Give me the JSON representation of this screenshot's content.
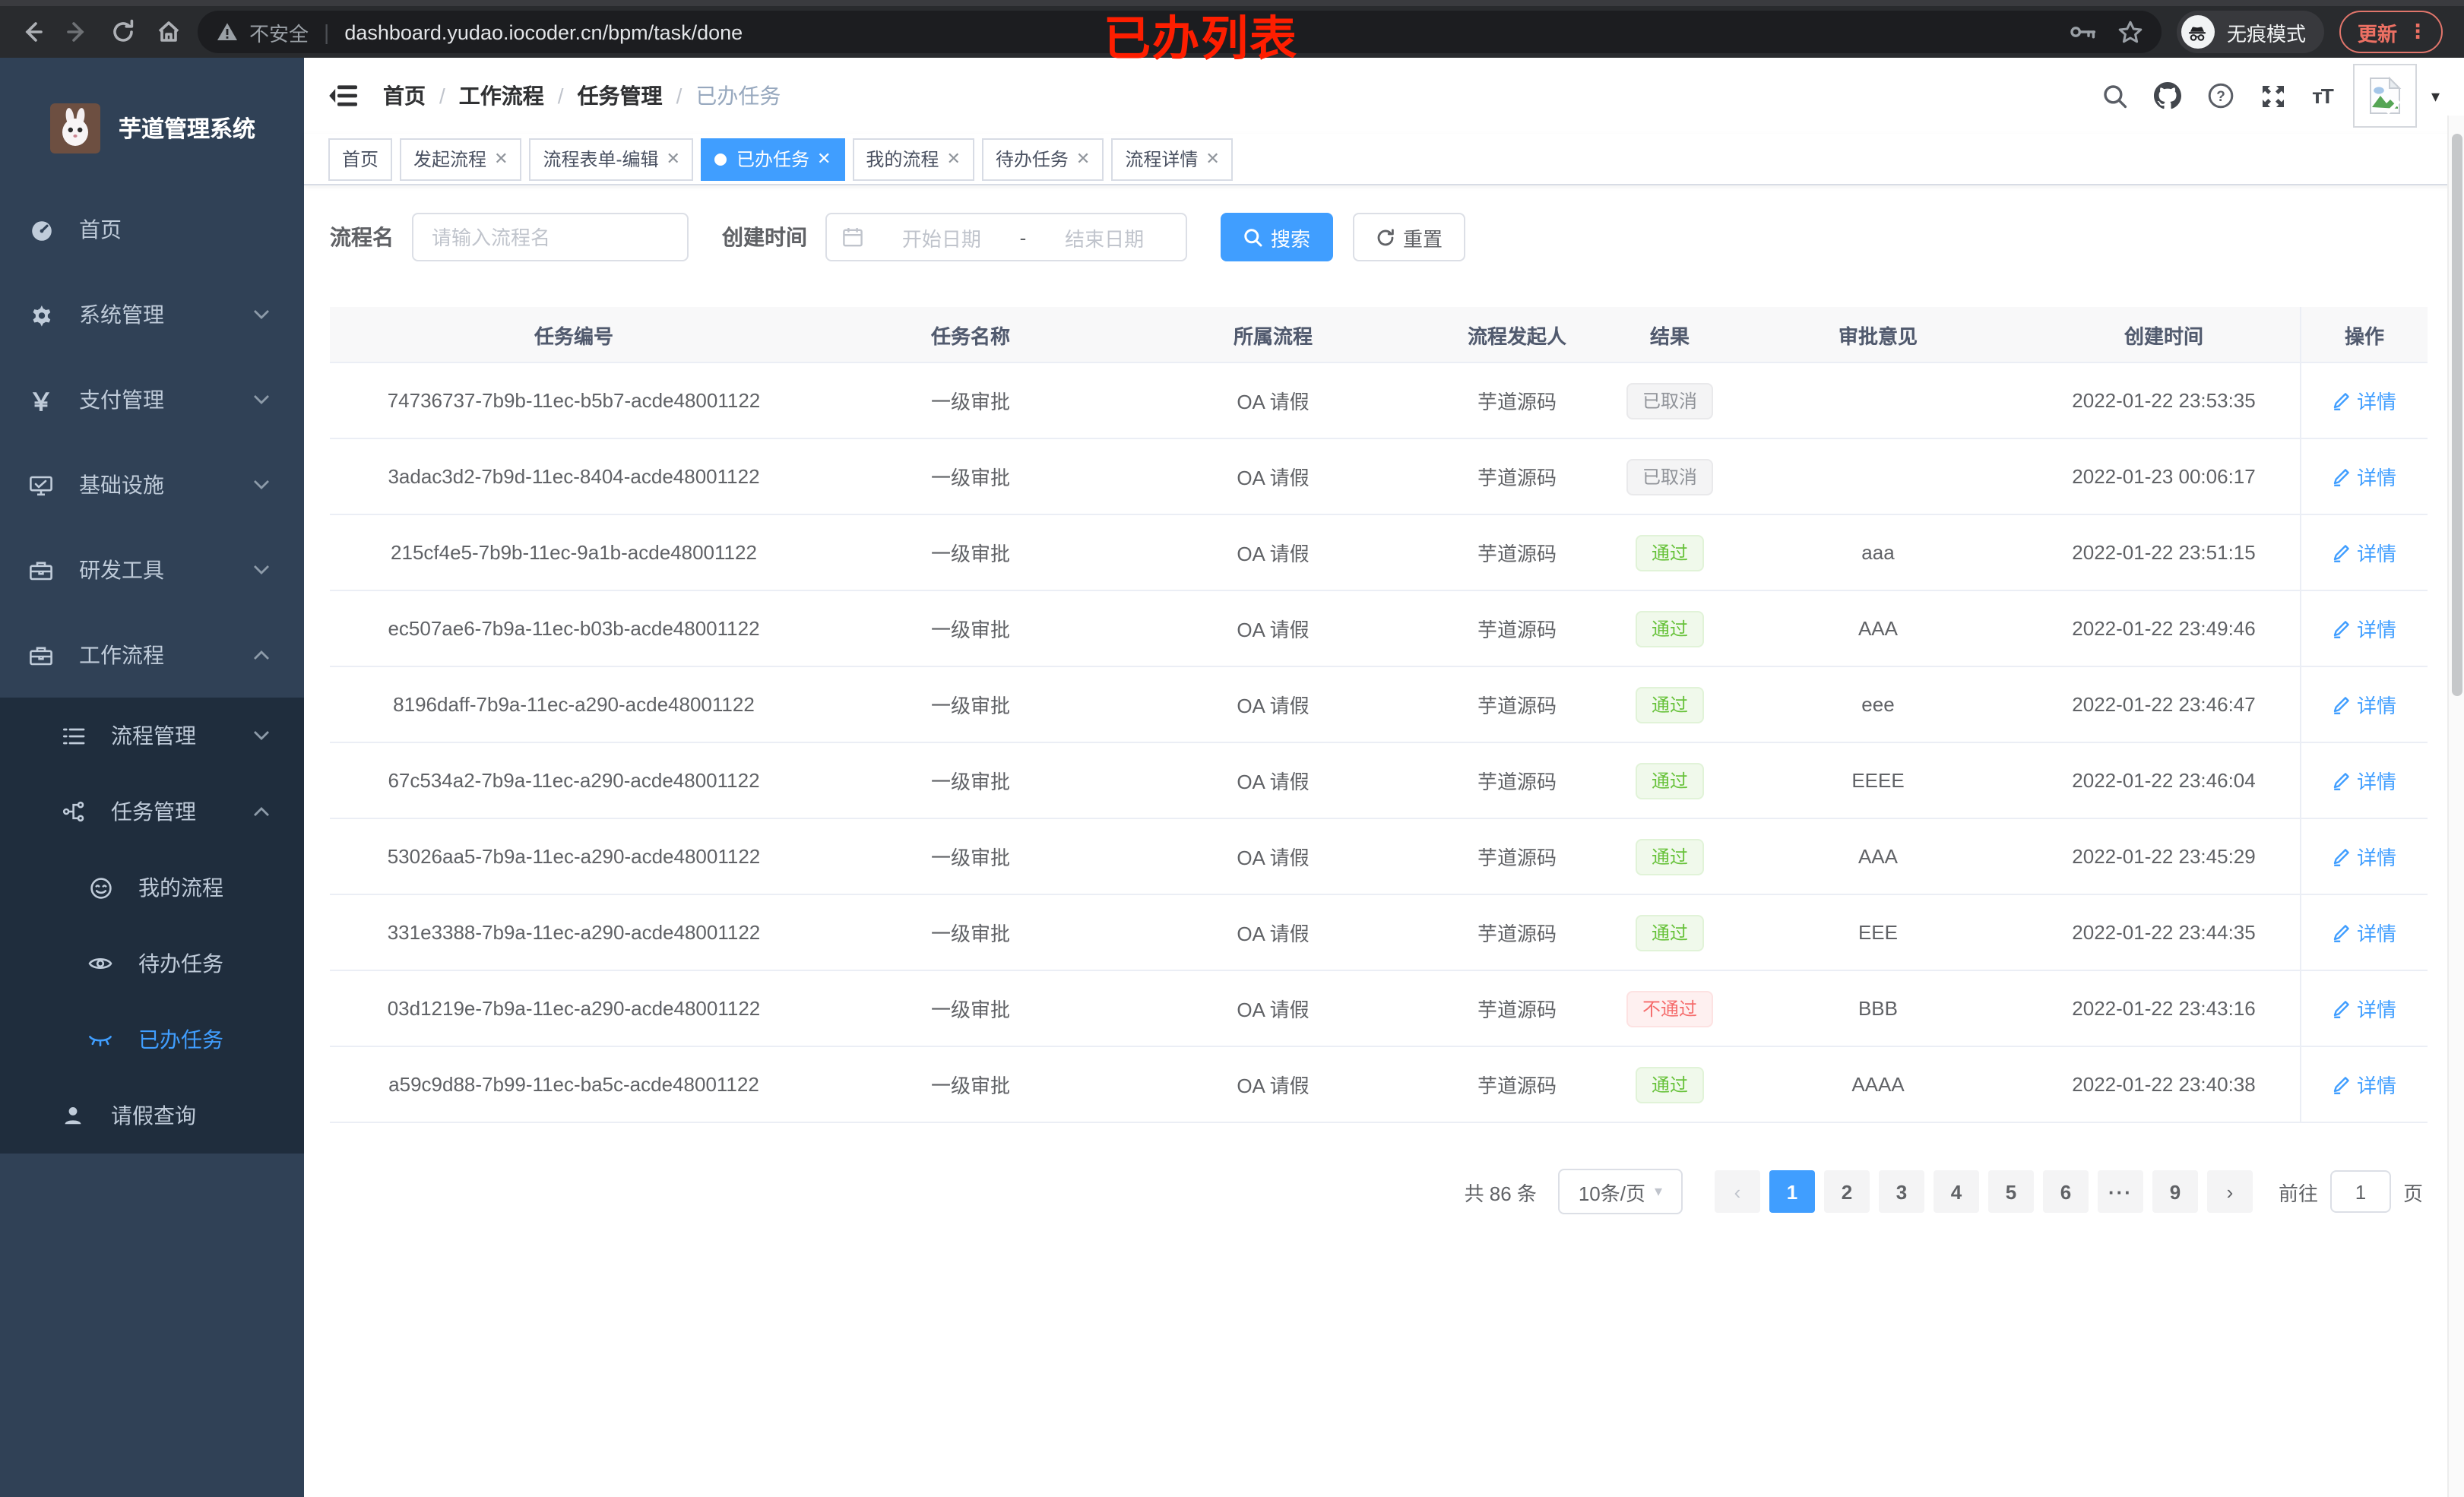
{
  "colors": {
    "accent": "#409eff",
    "success": "#67c23a",
    "danger": "#f56c6c",
    "info": "#909399",
    "sidebar_bg": "#304156",
    "submenu_bg": "#1f2d3d",
    "overlay_red": "#fe1e00",
    "chrome_bg": "#292b2e"
  },
  "browser": {
    "security_label": "不安全",
    "url": "dashboard.yudao.iocoder.cn/bpm/task/done",
    "incognito_label": "无痕模式",
    "update_label": "更新",
    "menu_dots": "⋮",
    "overlay_title": "已办列表"
  },
  "sidebar": {
    "app_title": "芋道管理系统",
    "items": [
      {
        "label": "首页",
        "icon": "dashboard-icon"
      },
      {
        "label": "系统管理",
        "icon": "gear-icon",
        "chevron": "down"
      },
      {
        "label": "支付管理",
        "icon": "yen-icon",
        "chevron": "down"
      },
      {
        "label": "基础设施",
        "icon": "monitor-icon",
        "chevron": "down"
      },
      {
        "label": "研发工具",
        "icon": "toolbox-icon",
        "chevron": "down"
      },
      {
        "label": "工作流程",
        "icon": "briefcase-icon",
        "chevron": "up"
      },
      {
        "label": "流程管理",
        "icon": "list-icon",
        "chevron": "down"
      },
      {
        "label": "任务管理",
        "icon": "tree-icon",
        "chevron": "up"
      },
      {
        "label": "我的流程",
        "icon": "face-icon"
      },
      {
        "label": "待办任务",
        "icon": "eye-icon"
      },
      {
        "label": "已办任务",
        "icon": "eye-closed-icon",
        "active": true
      },
      {
        "label": "请假查询",
        "icon": "user-icon"
      }
    ]
  },
  "breadcrumb": {
    "items": [
      "首页",
      "工作流程",
      "任务管理",
      "已办任务"
    ],
    "separator": "/"
  },
  "tabs": [
    {
      "label": "首页",
      "closable": false,
      "active": false
    },
    {
      "label": "发起流程",
      "closable": true,
      "active": false
    },
    {
      "label": "流程表单-编辑",
      "closable": true,
      "active": false
    },
    {
      "label": "已办任务",
      "closable": true,
      "active": true
    },
    {
      "label": "我的流程",
      "closable": true,
      "active": false
    },
    {
      "label": "待办任务",
      "closable": true,
      "active": false
    },
    {
      "label": "流程详情",
      "closable": true,
      "active": false
    }
  ],
  "filters": {
    "name_label": "流程名",
    "name_placeholder": "请输入流程名",
    "time_label": "创建时间",
    "start_placeholder": "开始日期",
    "range_separator": "-",
    "end_placeholder": "结束日期",
    "search_label": "搜索",
    "reset_label": "重置"
  },
  "table": {
    "headers": [
      "任务编号",
      "任务名称",
      "所属流程",
      "流程发起人",
      "结果",
      "审批意见",
      "创建时间",
      "操作"
    ],
    "action_label": "详情",
    "rows": [
      {
        "id": "74736737-7b9b-11ec-b5b7-acde48001122",
        "name": "一级审批",
        "process": "OA 请假",
        "starter": "芋道源码",
        "result": "已取消",
        "result_type": "info",
        "comment": "",
        "created": "2022-01-22 23:53:35"
      },
      {
        "id": "3adac3d2-7b9d-11ec-8404-acde48001122",
        "name": "一级审批",
        "process": "OA 请假",
        "starter": "芋道源码",
        "result": "已取消",
        "result_type": "info",
        "comment": "",
        "created": "2022-01-23 00:06:17"
      },
      {
        "id": "215cf4e5-7b9b-11ec-9a1b-acde48001122",
        "name": "一级审批",
        "process": "OA 请假",
        "starter": "芋道源码",
        "result": "通过",
        "result_type": "success",
        "comment": "aaa",
        "created": "2022-01-22 23:51:15"
      },
      {
        "id": "ec507ae6-7b9a-11ec-b03b-acde48001122",
        "name": "一级审批",
        "process": "OA 请假",
        "starter": "芋道源码",
        "result": "通过",
        "result_type": "success",
        "comment": "AAA",
        "created": "2022-01-22 23:49:46"
      },
      {
        "id": "8196daff-7b9a-11ec-a290-acde48001122",
        "name": "一级审批",
        "process": "OA 请假",
        "starter": "芋道源码",
        "result": "通过",
        "result_type": "success",
        "comment": "eee",
        "created": "2022-01-22 23:46:47"
      },
      {
        "id": "67c534a2-7b9a-11ec-a290-acde48001122",
        "name": "一级审批",
        "process": "OA 请假",
        "starter": "芋道源码",
        "result": "通过",
        "result_type": "success",
        "comment": "EEEE",
        "created": "2022-01-22 23:46:04"
      },
      {
        "id": "53026aa5-7b9a-11ec-a290-acde48001122",
        "name": "一级审批",
        "process": "OA 请假",
        "starter": "芋道源码",
        "result": "通过",
        "result_type": "success",
        "comment": "AAA",
        "created": "2022-01-22 23:45:29"
      },
      {
        "id": "331e3388-7b9a-11ec-a290-acde48001122",
        "name": "一级审批",
        "process": "OA 请假",
        "starter": "芋道源码",
        "result": "通过",
        "result_type": "success",
        "comment": "EEE",
        "created": "2022-01-22 23:44:35"
      },
      {
        "id": "03d1219e-7b9a-11ec-a290-acde48001122",
        "name": "一级审批",
        "process": "OA 请假",
        "starter": "芋道源码",
        "result": "不通过",
        "result_type": "danger",
        "comment": "BBB",
        "created": "2022-01-22 23:43:16"
      },
      {
        "id": "a59c9d88-7b99-11ec-ba5c-acde48001122",
        "name": "一级审批",
        "process": "OA 请假",
        "starter": "芋道源码",
        "result": "通过",
        "result_type": "success",
        "comment": "AAAA",
        "created": "2022-01-22 23:40:38"
      }
    ]
  },
  "pagination": {
    "total_text": "共 86 条",
    "page_size": "10条/页",
    "prev": "‹",
    "next": "›",
    "pages": [
      "1",
      "2",
      "3",
      "4",
      "5",
      "6"
    ],
    "ellipsis": "···",
    "last_page": "9",
    "goto_label": "前往",
    "goto_value": "1",
    "page_suffix": "页"
  },
  "icons": {
    "search": "magnifier",
    "github": "octocat-mark",
    "help": "question-circle",
    "fullscreen": "expand-arrows",
    "font_size": "tT",
    "key": "password-key",
    "star": "bookmark-star",
    "warning": "warning-triangle",
    "calendar": "calendar",
    "edit": "pencil"
  }
}
